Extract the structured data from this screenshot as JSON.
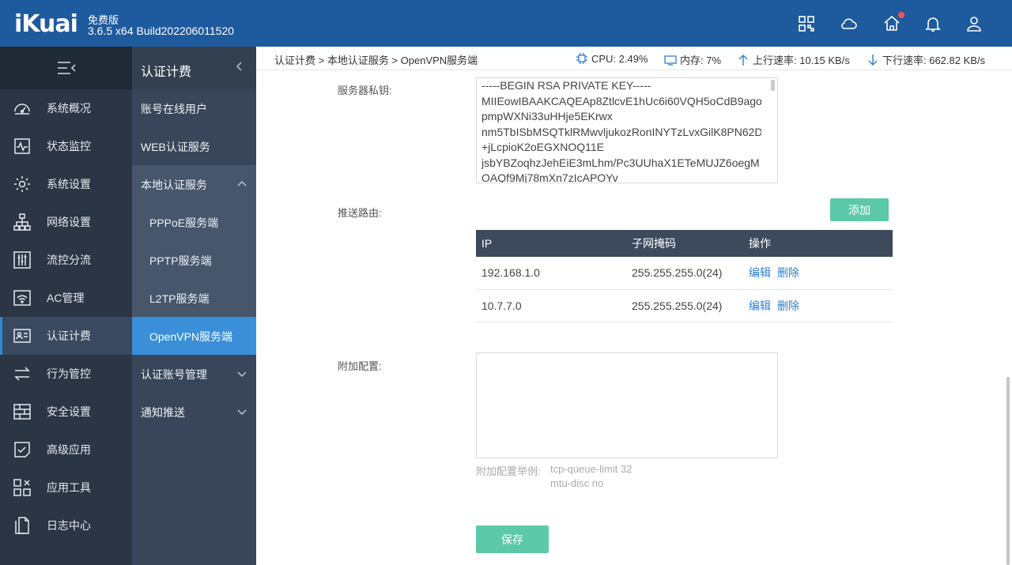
{
  "header": {
    "logo": "iKuai",
    "edition": "免费版",
    "version": "3.6.5 x64 Build202206011520"
  },
  "sidebar": {
    "items": [
      {
        "label": "系统概况",
        "icon": "dashboard-icon"
      },
      {
        "label": "状态监控",
        "icon": "monitor-icon"
      },
      {
        "label": "系统设置",
        "icon": "gear-icon"
      },
      {
        "label": "网络设置",
        "icon": "network-icon"
      },
      {
        "label": "流控分流",
        "icon": "sliders-icon"
      },
      {
        "label": "AC管理",
        "icon": "wifi-icon"
      },
      {
        "label": "认证计费",
        "icon": "id-card-icon"
      },
      {
        "label": "行为管控",
        "icon": "arrows-icon"
      },
      {
        "label": "安全设置",
        "icon": "firewall-icon"
      },
      {
        "label": "高级应用",
        "icon": "advanced-app-icon"
      },
      {
        "label": "应用工具",
        "icon": "tools-icon"
      },
      {
        "label": "日志中心",
        "icon": "log-icon"
      }
    ]
  },
  "subnav": {
    "title": "认证计费",
    "items": [
      {
        "label": "账号在线用户"
      },
      {
        "label": "WEB认证服务"
      },
      {
        "label": "本地认证服务"
      },
      {
        "label": "PPPoE服务端"
      },
      {
        "label": "PPTP服务端"
      },
      {
        "label": "L2TP服务端"
      },
      {
        "label": "OpenVPN服务端"
      },
      {
        "label": "认证账号管理"
      },
      {
        "label": "通知推送"
      }
    ]
  },
  "breadcrumb": "认证计费 > 本地认证服务 > OpenVPN服务端",
  "stats": {
    "cpu": "CPU: 2.49%",
    "memory": "内存: 7%",
    "upload": "上行速率: 10.15 KB/s",
    "download": "下行速率: 662.82 KB/s"
  },
  "form": {
    "private_key_label": "服务器私钥:",
    "private_key_lines": [
      "-----BEGIN RSA PRIVATE KEY-----",
      "MIIEowIBAAKCAQEAp8ZtlcvE1hUc6i60VQH5oCdB9ago",
      "pmpWXNi33uHHje5EKrwx",
      "nm5TbISbMSQTklRMwvljukozRonINYTzLvxGilK8PN62D",
      "+jLcpioK2oEGXNOQ11E",
      "jsbYBZoqhzJehEiE3mLhm/Pc3UUhaX1ETeMUJZ6oegM",
      "OAQf9Mj78mXn7zIcAPOYv"
    ],
    "push_route_label": "推送路由:",
    "add_label": "添加",
    "table": {
      "headers": [
        "IP",
        "子网掩码",
        "操作"
      ],
      "rows": [
        {
          "ip": "192.168.1.0",
          "mask": "255.255.255.0(24)"
        },
        {
          "ip": "10.7.7.0",
          "mask": "255.255.255.0(24)"
        }
      ],
      "edit_label": "编辑",
      "delete_label": "删除"
    },
    "extra_label": "附加配置:",
    "extra_hint_label": "附加配置举例:",
    "extra_hint_lines": [
      "tcp-queue-limit 32",
      "mtu-disc no"
    ],
    "save_label": "保存"
  },
  "colors": {
    "header": "#1e5a9e",
    "accent_green": "#5bc9a7",
    "active_blue": "#3b8fd8"
  }
}
